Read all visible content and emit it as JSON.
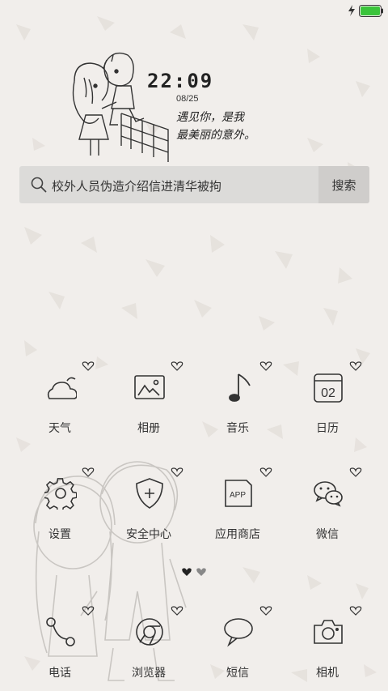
{
  "status_bar": {
    "battery_level": 1.0,
    "charging": true,
    "battery_color": "#3bc43b"
  },
  "clock": {
    "time": "22:09",
    "date": "08/25",
    "quote_line1": "遇见你，是我",
    "quote_line2": "最美丽的意外。"
  },
  "search": {
    "query": "校外人员伪造介绍信进清华被拘",
    "button_label": "搜索"
  },
  "apps": [
    {
      "label": "天气",
      "icon": "weather-icon"
    },
    {
      "label": "相册",
      "icon": "gallery-icon"
    },
    {
      "label": "音乐",
      "icon": "music-icon"
    },
    {
      "label": "日历",
      "icon": "calendar-icon",
      "badge": "02"
    },
    {
      "label": "设置",
      "icon": "settings-icon"
    },
    {
      "label": "安全中心",
      "icon": "security-icon"
    },
    {
      "label": "应用商店",
      "icon": "app-store-icon",
      "badge": "APP"
    },
    {
      "label": "微信",
      "icon": "wechat-icon"
    },
    {
      "label": "电话",
      "icon": "phone-icon"
    },
    {
      "label": "浏览器",
      "icon": "browser-icon"
    },
    {
      "label": "短信",
      "icon": "message-icon"
    },
    {
      "label": "相机",
      "icon": "camera-icon"
    }
  ],
  "pager": {
    "page_count": 2,
    "current_page": 1
  },
  "colors": {
    "background": "#f1eeeb",
    "icon_stroke": "#333333",
    "search_bg": "#dcdbd9"
  }
}
